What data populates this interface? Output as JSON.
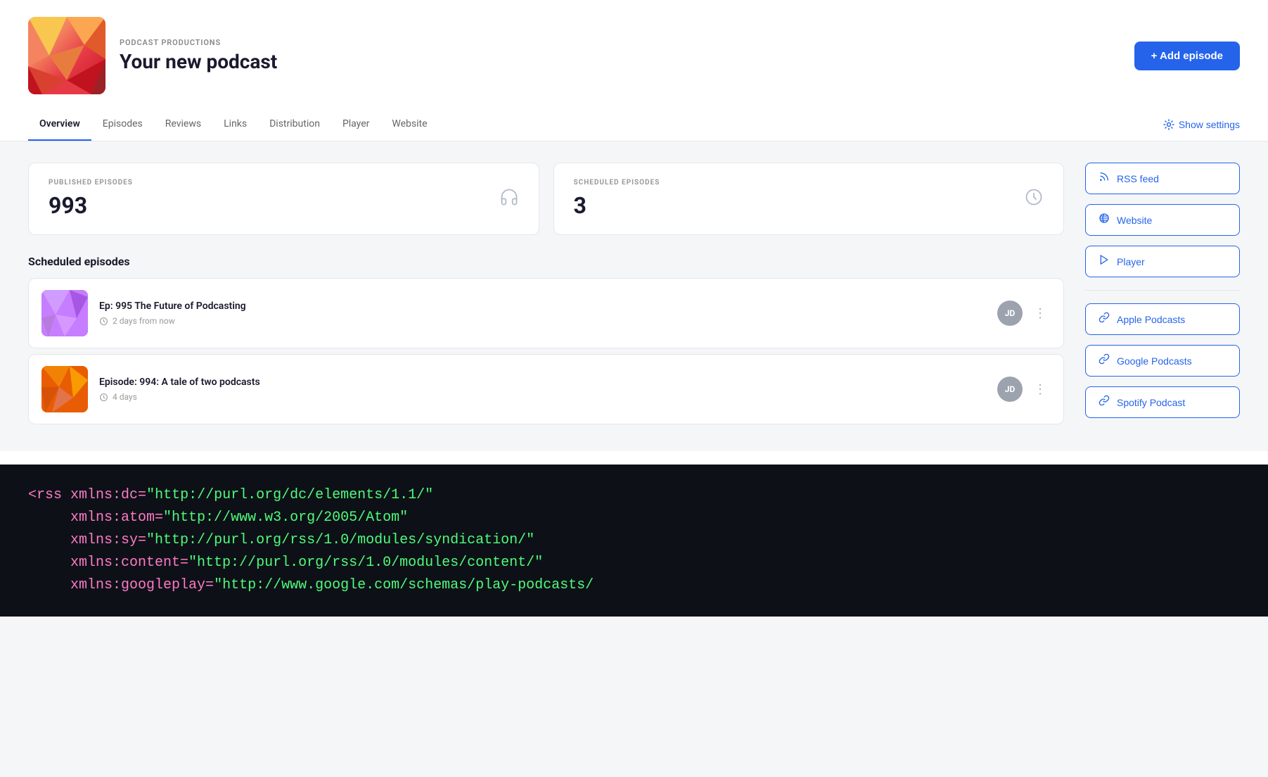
{
  "header": {
    "brand_label": "PODCAST PRODUCTIONS",
    "podcast_title": "Your new podcast",
    "add_episode_label": "+ Add episode"
  },
  "nav": {
    "tabs": [
      {
        "id": "overview",
        "label": "Overview",
        "active": true
      },
      {
        "id": "episodes",
        "label": "Episodes",
        "active": false
      },
      {
        "id": "reviews",
        "label": "Reviews",
        "active": false
      },
      {
        "id": "links",
        "label": "Links",
        "active": false
      },
      {
        "id": "distribution",
        "label": "Distribution",
        "active": false
      },
      {
        "id": "player",
        "label": "Player",
        "active": false
      },
      {
        "id": "website",
        "label": "Website",
        "active": false
      }
    ],
    "show_settings_label": "Show settings"
  },
  "stats": {
    "published": {
      "label": "PUBLISHED EPISODES",
      "value": "993"
    },
    "scheduled": {
      "label": "SCHEDULED EPISODES",
      "value": "3"
    }
  },
  "scheduled_section": {
    "title": "Scheduled episodes",
    "episodes": [
      {
        "title": "Ep: 995 The Future of Podcasting",
        "meta": "2 days from now",
        "avatar_initials": "JD",
        "thumb_class": "episode-thumb-1"
      },
      {
        "title": "Episode: 994: A tale of two podcasts",
        "meta": "4 days",
        "avatar_initials": "JD",
        "thumb_class": "episode-thumb-2"
      }
    ]
  },
  "sidebar": {
    "buttons": [
      {
        "id": "rss-feed",
        "label": "RSS feed",
        "icon": "rss"
      },
      {
        "id": "website",
        "label": "Website",
        "icon": "globe"
      },
      {
        "id": "player",
        "label": "Player",
        "icon": "play"
      },
      {
        "id": "apple-podcasts",
        "label": "Apple Podcasts",
        "icon": "link"
      },
      {
        "id": "google-podcasts",
        "label": "Google Podcasts",
        "icon": "link"
      },
      {
        "id": "spotify-podcast",
        "label": "Spotify Podcast",
        "icon": "link"
      }
    ]
  },
  "code_block": {
    "lines": [
      "<rss xmlns:dc=\"http://purl.org/dc/elements/1.1/\"",
      "     xmlns:atom=\"http://www.w3.org/2005/Atom\"",
      "     xmlns:sy=\"http://purl.org/rss/1.0/modules/syndication/\"",
      "     xmlns:content=\"http://purl.org/rss/1.0/modules/content/\"",
      "     xmlns:googleplay=\"http://www.google.com/schemas/play-podcasts/"
    ]
  }
}
